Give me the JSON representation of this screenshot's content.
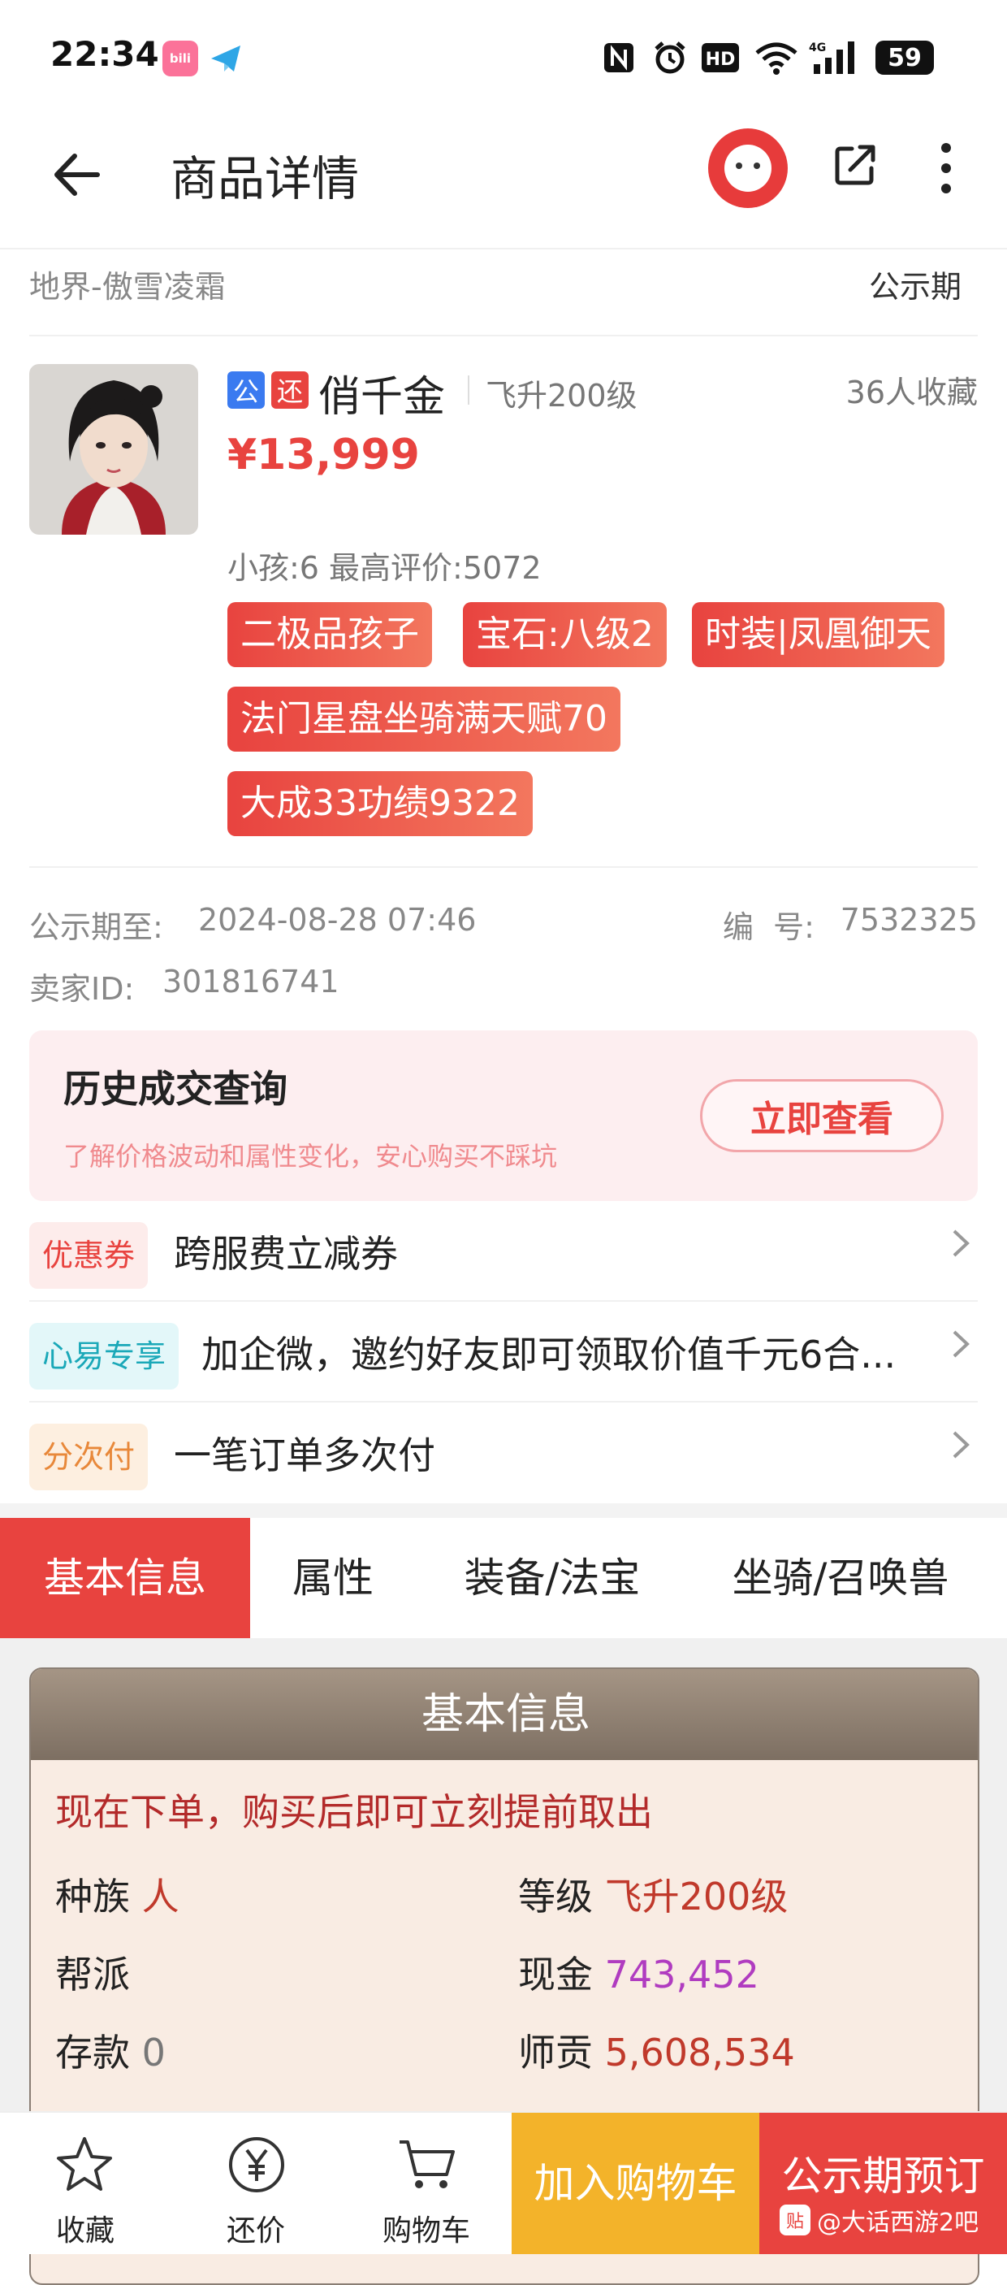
{
  "status_bar": {
    "time": "22:34",
    "app1_label": "bili",
    "battery": "59"
  },
  "header": {
    "title": "商品详情"
  },
  "server": {
    "name": "地界-傲雪凌霜",
    "status": "公示期"
  },
  "product": {
    "badge1": "公",
    "badge2": "还",
    "name": "俏千金",
    "level": "飞升200级",
    "favorites": "36人收藏",
    "price": "¥13,999",
    "sub_info": "小孩:6 最高评价:5072",
    "tags": [
      "二极品孩子",
      "宝石:八级2",
      "时装|凤凰御天",
      "法门星盘坐骑满天赋70",
      "大成33功绩9322"
    ]
  },
  "meta": {
    "period_label": "公示期至:",
    "period_value": "2024-08-28 07:46",
    "id_label": "编  号:",
    "id_value": "7532325",
    "seller_label": "卖家ID:",
    "seller_value": "301816741"
  },
  "history": {
    "title": "历史成交查询",
    "subtitle": "了解价格波动和属性变化，安心购买不踩坑",
    "button": "立即查看"
  },
  "promos": [
    {
      "label": "优惠券",
      "text": "跨服费立减券",
      "label_color": "#e8433f",
      "label_bg": "#fdeceb"
    },
    {
      "label": "心易专享",
      "text": "加企微，邀约好友即可领取价值千元6合...",
      "label_color": "#1aa8b8",
      "label_bg": "#e3f7f9"
    },
    {
      "label": "分次付",
      "text": "一笔订单多次付",
      "label_color": "#e8883a",
      "label_bg": "#fdefe0"
    }
  ],
  "tabs": [
    "基本信息",
    "属性",
    "装备/法宝",
    "坐骑/召唤兽"
  ],
  "info_card": {
    "title": "基本信息",
    "notice": "现在下单，购买后即可立刻提前取出",
    "fields": [
      {
        "k": "种族",
        "v": "人",
        "color": "#c0392b"
      },
      {
        "k": "等级",
        "v": "飞升200级",
        "color": "#c0392b"
      },
      {
        "k": "帮派",
        "v": "",
        "color": "#222"
      },
      {
        "k": "现金",
        "v": "743,452",
        "color": "#b03cc0"
      },
      {
        "k": "存款",
        "v": "0",
        "color": "#777"
      },
      {
        "k": "师贡",
        "v": "5,608,534",
        "color": "#c0392b"
      }
    ]
  },
  "bottom_bar": {
    "favorite": "收藏",
    "bargain": "还价",
    "cart": "购物车",
    "add_cart": "加入购物车",
    "preorder": "公示期预订",
    "watermark": "@大话西游2吧",
    "watermark_logo": "贴"
  },
  "colors": {
    "accent": "#e8433f",
    "price": "#e8433f",
    "cart": "#f3b32a"
  }
}
